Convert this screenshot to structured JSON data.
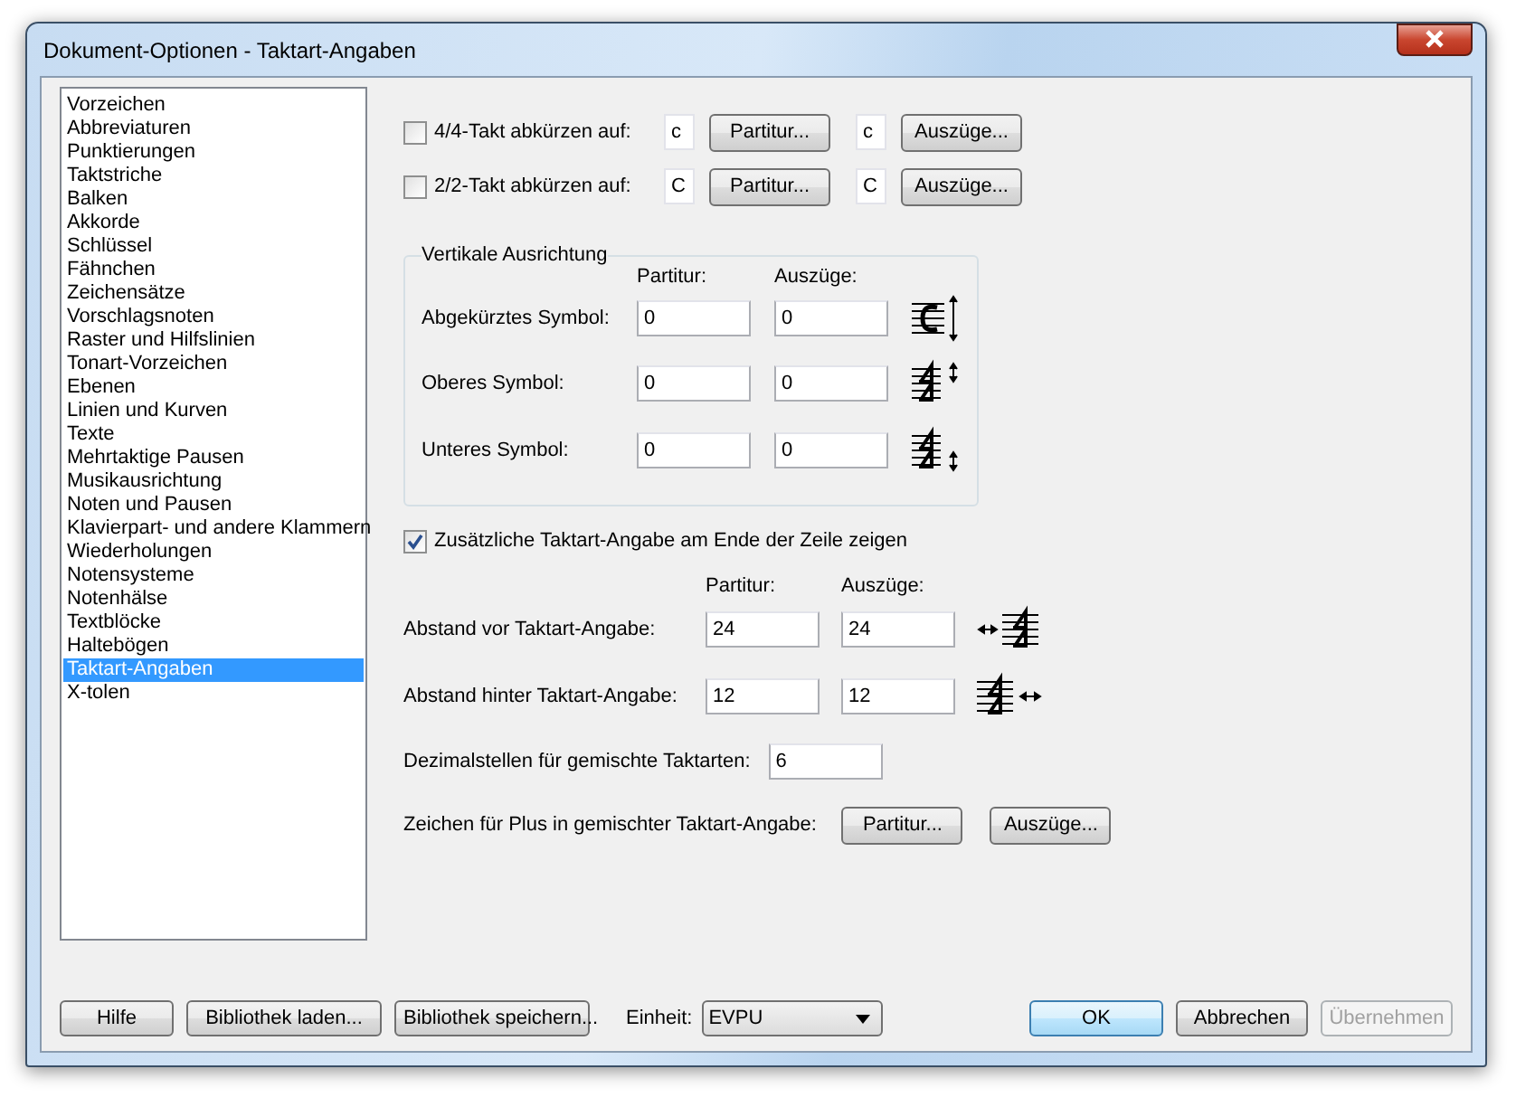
{
  "window": {
    "title": "Dokument-Optionen - Taktart-Angaben"
  },
  "sidebar": {
    "items": [
      {
        "label": "Vorzeichen",
        "selected": false
      },
      {
        "label": "Abbreviaturen",
        "selected": false
      },
      {
        "label": "Punktierungen",
        "selected": false
      },
      {
        "label": "Taktstriche",
        "selected": false
      },
      {
        "label": "Balken",
        "selected": false
      },
      {
        "label": "Akkorde",
        "selected": false
      },
      {
        "label": "Schlüssel",
        "selected": false
      },
      {
        "label": "Fähnchen",
        "selected": false
      },
      {
        "label": "Zeichensätze",
        "selected": false
      },
      {
        "label": "Vorschlagsnoten",
        "selected": false
      },
      {
        "label": "Raster und Hilfslinien",
        "selected": false
      },
      {
        "label": "Tonart-Vorzeichen",
        "selected": false
      },
      {
        "label": "Ebenen",
        "selected": false
      },
      {
        "label": "Linien und Kurven",
        "selected": false
      },
      {
        "label": "Texte",
        "selected": false
      },
      {
        "label": "Mehrtaktige Pausen",
        "selected": false
      },
      {
        "label": "Musikausrichtung",
        "selected": false
      },
      {
        "label": "Noten und Pausen",
        "selected": false
      },
      {
        "label": "Klavierpart- und andere Klammern",
        "selected": false
      },
      {
        "label": "Wiederholungen",
        "selected": false
      },
      {
        "label": "Notensysteme",
        "selected": false
      },
      {
        "label": "Notenhälse",
        "selected": false
      },
      {
        "label": "Textblöcke",
        "selected": false
      },
      {
        "label": "Haltebögen",
        "selected": false
      },
      {
        "label": "Taktart-Angaben",
        "selected": true
      },
      {
        "label": "X-tolen",
        "selected": false
      }
    ]
  },
  "abbreviations": [
    {
      "checked": false,
      "label": "4/4-Takt abkürzen auf:",
      "score_symbol": "c",
      "score_button": "Partitur...",
      "parts_symbol": "c",
      "parts_button": "Auszüge..."
    },
    {
      "checked": false,
      "label": "2/2-Takt abkürzen auf:",
      "score_symbol": "C",
      "score_button": "Partitur...",
      "parts_symbol": "C",
      "parts_button": "Auszüge..."
    }
  ],
  "vertical_alignment": {
    "title": "Vertikale Ausrichtung",
    "headers": [
      "Partitur:",
      "Auszüge:"
    ],
    "rows": [
      {
        "label": "Abgekürztes Symbol:",
        "score": "0",
        "parts": "0"
      },
      {
        "label": "Oberes Symbol:",
        "score": "0",
        "parts": "0"
      },
      {
        "label": "Unteres Symbol:",
        "score": "0",
        "parts": "0"
      }
    ]
  },
  "end_of_line": {
    "checked": true,
    "label": "Zusätzliche Taktart-Angabe am Ende der Zeile zeigen"
  },
  "spacing": {
    "headers": [
      "Partitur:",
      "Auszüge:"
    ],
    "rows": [
      {
        "label": "Abstand vor Taktart-Angabe:",
        "score": "24",
        "parts": "24"
      },
      {
        "label": "Abstand hinter Taktart-Angabe:",
        "score": "12",
        "parts": "12"
      }
    ]
  },
  "decimals": {
    "label": "Dezimalstellen für gemischte Taktarten:",
    "value": "6"
  },
  "plus_sign": {
    "label": "Zeichen für Plus in gemischter Taktart-Angabe:",
    "buttons": [
      "Partitur...",
      "Auszüge..."
    ]
  },
  "footer": {
    "left_buttons": [
      "Hilfe",
      "Bibliothek laden...",
      "Bibliothek speichern..."
    ],
    "unit_label": "Einheit:",
    "unit_value": "EVPU",
    "right_buttons": [
      {
        "label": "OK",
        "default": true,
        "disabled": false
      },
      {
        "label": "Abbrechen",
        "default": false,
        "disabled": false
      },
      {
        "label": "Übernehmen",
        "default": false,
        "disabled": true
      }
    ]
  }
}
